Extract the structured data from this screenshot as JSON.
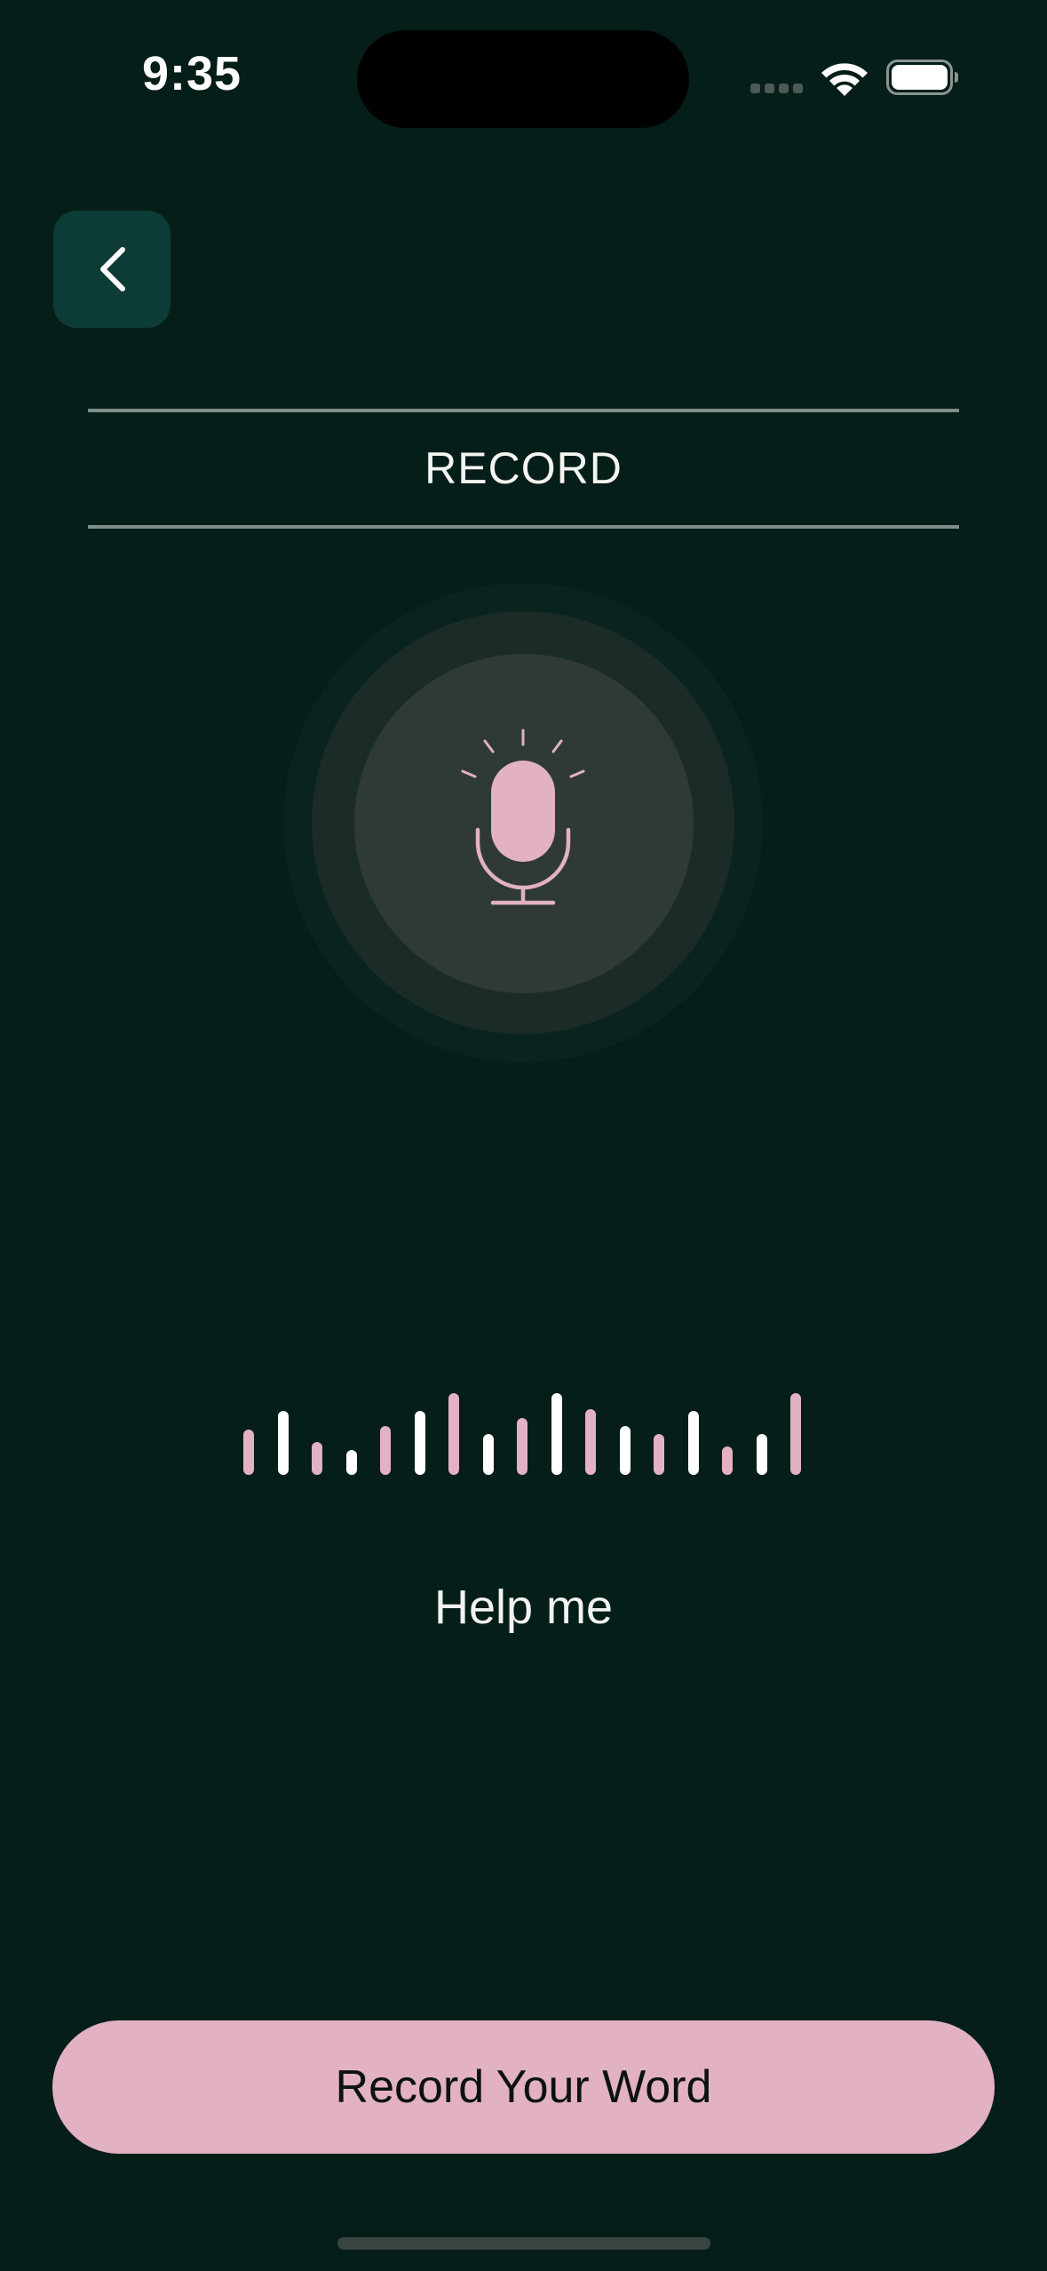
{
  "status_bar": {
    "time": "9:35",
    "icons": [
      "cellular-signal-icon",
      "wifi-icon",
      "battery-icon"
    ]
  },
  "nav": {
    "back_icon": "chevron-left-icon"
  },
  "header": {
    "title": "RECORD"
  },
  "recorder": {
    "mic_icon": "microphone-icon",
    "waveform_levels": [
      0.55,
      0.78,
      0.4,
      0.3,
      0.6,
      0.78,
      1.0,
      0.5,
      0.7,
      1.0,
      0.8,
      0.6,
      0.5,
      0.78,
      0.35,
      0.5,
      1.0
    ],
    "waveform_colors": [
      "#e2b1c4",
      "#ffffff"
    ]
  },
  "transcript": {
    "text": "Help me"
  },
  "actions": {
    "record_label": "Record Your Word"
  },
  "colors": {
    "background": "#061e19",
    "accent": "#e2b1c4",
    "back_button": "#0d3b35"
  }
}
